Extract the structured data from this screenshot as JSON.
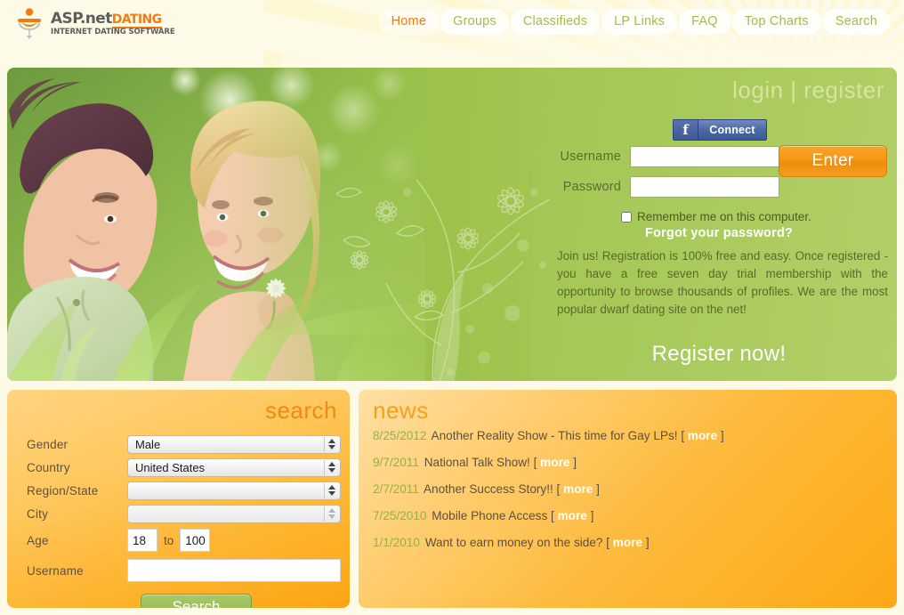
{
  "header": {
    "logo": {
      "icon": "dating-figure-icon",
      "name_main": "ASP.net",
      "name_accent": "DATING",
      "tagline": "INTERNET DATING SOFTWARE"
    },
    "nav": [
      {
        "label": "Home",
        "active": true
      },
      {
        "label": "Groups",
        "active": false
      },
      {
        "label": "Classifieds",
        "active": false
      },
      {
        "label": "LP Links",
        "active": false
      },
      {
        "label": "FAQ",
        "active": false
      },
      {
        "label": "Top Charts",
        "active": false
      },
      {
        "label": "Search",
        "active": false
      }
    ]
  },
  "hero": {
    "login_link": "login",
    "separator": "|",
    "register_link": "register",
    "facebook": {
      "glyph": "f",
      "label": "Connect"
    },
    "username_label": "Username",
    "username_value": "",
    "password_label": "Password",
    "password_value": "",
    "enter_button": "Enter",
    "remember_label": "Remember me on this computer.",
    "remember_checked": false,
    "forgot_link": "Forgot your password?",
    "promo_text": "Join us! Registration is 100% free and easy. Once registered - you have a free seven day trial membership with the opportunity to browse thousands of profiles.  We are the most popular dwarf dating site on the net!",
    "register_now": "Register now!"
  },
  "search_panel": {
    "title": "search",
    "fields": {
      "gender": {
        "label": "Gender",
        "value": "Male",
        "disabled": false
      },
      "country": {
        "label": "Country",
        "value": "United States",
        "disabled": false
      },
      "region": {
        "label": "Region/State",
        "value": "",
        "disabled": false
      },
      "city": {
        "label": "City",
        "value": "",
        "disabled": true
      },
      "age": {
        "label": "Age",
        "from": "18",
        "to_label": "to",
        "to": "100"
      },
      "username": {
        "label": "Username",
        "value": ""
      }
    },
    "submit_button": "Search"
  },
  "news_panel": {
    "title": "news",
    "bracket_open": "[",
    "bracket_close": "]",
    "more_label": "more",
    "items": [
      {
        "date": "8/25/2012",
        "title": "Another Reality Show - This time for Gay LPs!"
      },
      {
        "date": "9/7/2011",
        "title": "National Talk Show!"
      },
      {
        "date": "2/7/2011",
        "title": "Another Success Story!!"
      },
      {
        "date": "7/25/2010",
        "title": "Mobile Phone Access"
      },
      {
        "date": "1/1/2010",
        "title": "Want to earn money on the side?"
      }
    ]
  },
  "colors": {
    "page_bg": "#fdfbe8",
    "brand_orange": "#f07c12",
    "nav_green": "#9dbf4e",
    "hero_green": "#9cc24a",
    "panel_orange": "#fca815",
    "news_date_green": "#8fb34a"
  }
}
